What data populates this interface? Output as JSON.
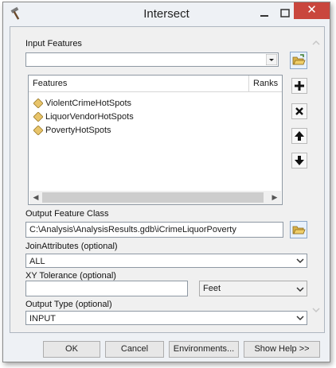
{
  "window": {
    "title": "Intersect"
  },
  "input_features": {
    "label": "Input Features",
    "value": "",
    "table": {
      "headers": [
        "Features",
        "Ranks"
      ],
      "items": [
        {
          "name": "ViolentCrimeHotSpots"
        },
        {
          "name": "LiquorVendorHotSpots"
        },
        {
          "name": "PovertyHotSpots"
        }
      ]
    }
  },
  "output_feature_class": {
    "label": "Output Feature Class",
    "value": "C:\\Analysis\\AnalysisResults.gdb\\iCrimeLiquorPoverty"
  },
  "join_attributes": {
    "label": "JoinAttributes (optional)",
    "value": "ALL"
  },
  "xy_tolerance": {
    "label": "XY Tolerance (optional)",
    "value": "",
    "units": "Feet"
  },
  "output_type": {
    "label": "Output Type (optional)",
    "value": "INPUT"
  },
  "buttons": {
    "ok": "OK",
    "cancel": "Cancel",
    "environments": "Environments...",
    "show_help": "Show Help >>"
  },
  "icons": {
    "app": "hammer-icon",
    "folder": "open-folder-icon",
    "add": "plus-icon",
    "remove": "x-icon",
    "up": "up-arrow-icon",
    "down": "down-arrow-icon",
    "feature": "feature-class-diamond-icon",
    "dropdown": "chevron-down-icon"
  },
  "colors": {
    "close": "#c9463d",
    "diamond": "#e8c46a",
    "folder": "#d9b24a"
  }
}
